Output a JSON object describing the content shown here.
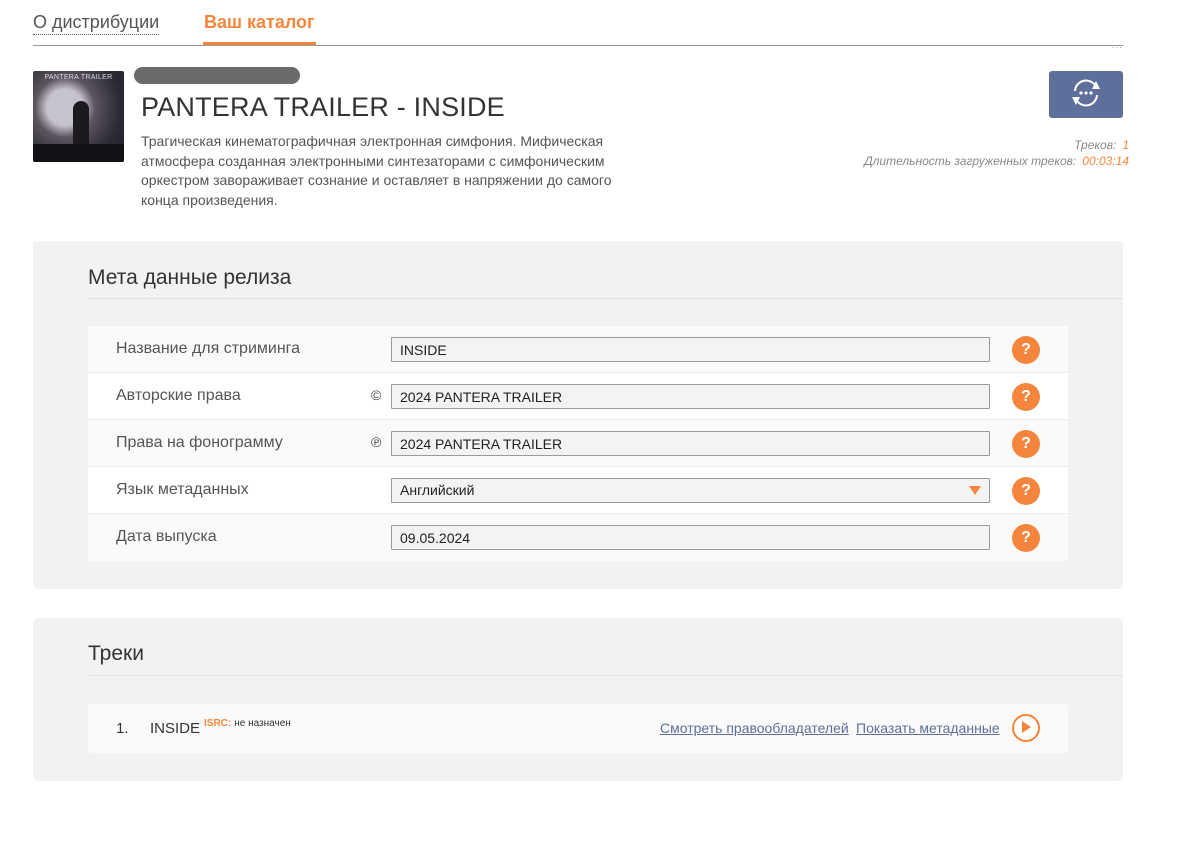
{
  "tabs": [
    {
      "label": "О дистрибуции"
    },
    {
      "label": "Ваш каталог"
    }
  ],
  "release": {
    "cover_text": "PANTERA TRAILER",
    "title": "PANTERA TRAILER - INSIDE",
    "description": "Трагическая кинематографичная электронная симфония. Мифическая атмосфера созданная электронными синтезаторами с симфоническим оркестром завораживает сознание и оставляет в напряжении до самого конца произведения.",
    "stats": {
      "tracks_label": "Треков:",
      "tracks_value": "1",
      "duration_label": "Длительность загруженных треков:",
      "duration_value": "00:03:14"
    }
  },
  "meta": {
    "title": "Мета данные релиза",
    "rows": [
      {
        "label": "Название для стриминга",
        "symbol": "",
        "value": "INSIDE"
      },
      {
        "label": "Авторские права",
        "symbol": "©",
        "value": "2024 PANTERA TRAILER"
      },
      {
        "label": "Права на фонограмму",
        "symbol": "℗",
        "value": "2024 PANTERA TRAILER"
      },
      {
        "label": "Язык метаданных",
        "symbol": "",
        "value": "Английский"
      },
      {
        "label": "Дата выпуска",
        "symbol": "",
        "value": "09.05.2024"
      }
    ],
    "help_symbol": "?"
  },
  "tracks": {
    "title": "Треки",
    "items": [
      {
        "number": "1.",
        "name": "INSIDE",
        "isrc_label": "ISRC:",
        "isrc_value": "не назначен",
        "link_rights": "Смотреть правообладателей",
        "link_meta": "Показать метаданные"
      }
    ]
  },
  "icons": {
    "sync": "sync-refresh-icon",
    "help": "question-icon",
    "play": "play-icon"
  },
  "colors": {
    "accent": "#f5853c",
    "button": "#5f6f9c",
    "panel": "#f2f2f2"
  }
}
